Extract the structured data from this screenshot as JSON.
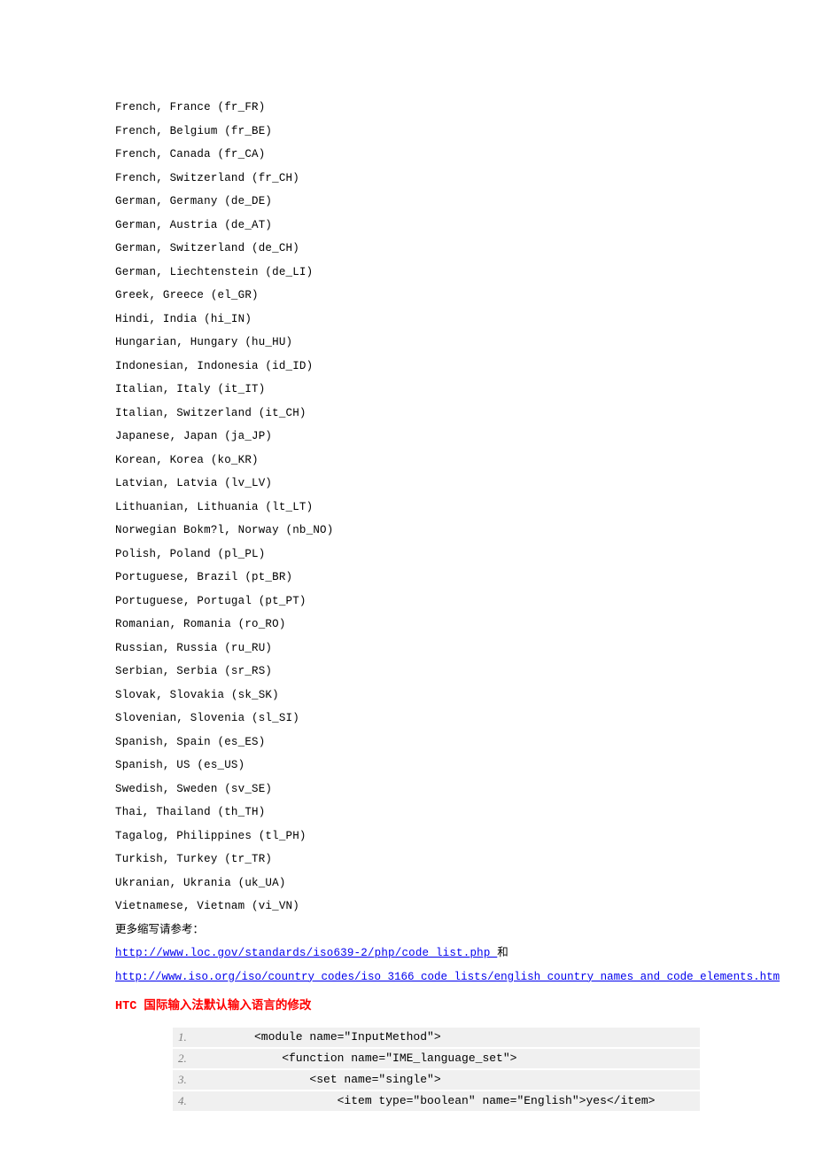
{
  "locales": [
    "French, France (fr_FR)",
    "French, Belgium (fr_BE)",
    "French, Canada (fr_CA)",
    "French, Switzerland (fr_CH)",
    "German, Germany (de_DE)",
    "German, Austria (de_AT)",
    "German, Switzerland (de_CH)",
    "German, Liechtenstein (de_LI)",
    "Greek, Greece (el_GR)",
    "Hindi, India (hi_IN)",
    "Hungarian, Hungary (hu_HU)",
    "Indonesian, Indonesia (id_ID)",
    "Italian, Italy (it_IT)",
    "Italian, Switzerland (it_CH)",
    "Japanese, Japan (ja_JP)",
    "Korean, Korea (ko_KR)",
    "Latvian, Latvia (lv_LV)",
    "Lithuanian, Lithuania (lt_LT)",
    "Norwegian Bokm?l, Norway (nb_NO)",
    "Polish, Poland (pl_PL)",
    "Portuguese, Brazil (pt_BR)",
    "Portuguese, Portugal (pt_PT)",
    "Romanian, Romania (ro_RO)",
    "Russian, Russia (ru_RU)",
    "Serbian, Serbia (sr_RS)",
    "Slovak, Slovakia (sk_SK)",
    "Slovenian, Slovenia (sl_SI)",
    "Spanish, Spain (es_ES)",
    "Spanish, US (es_US)",
    "Swedish, Sweden (sv_SE)",
    "Thai, Thailand (th_TH)",
    "Tagalog, Philippines (tl_PH)",
    "Turkish, Turkey (tr_TR)",
    "Ukranian, Ukrania (uk_UA)",
    "Vietnamese, Vietnam (vi_VN)"
  ],
  "more_ref_text": "更多缩写请参考：",
  "link1_text": "http://www.loc.gov/standards/iso639-2/php/code_list.php ",
  "link1_suffix": "和",
  "link2_text": "http://www.iso.org/iso/country_codes/iso_3166_code_lists/english_country_names_and_code_elements.htm",
  "heading": "HTC 国际输入法默认输入语言的修改",
  "code": [
    {
      "n": "1.",
      "t": "<module name=\"InputMethod\">"
    },
    {
      "n": "2.",
      "t": "    <function name=\"IME_language_set\">"
    },
    {
      "n": "3.",
      "t": "        <set name=\"single\">"
    },
    {
      "n": "4.",
      "t": "            <item type=\"boolean\" name=\"English\">yes</item>"
    }
  ]
}
